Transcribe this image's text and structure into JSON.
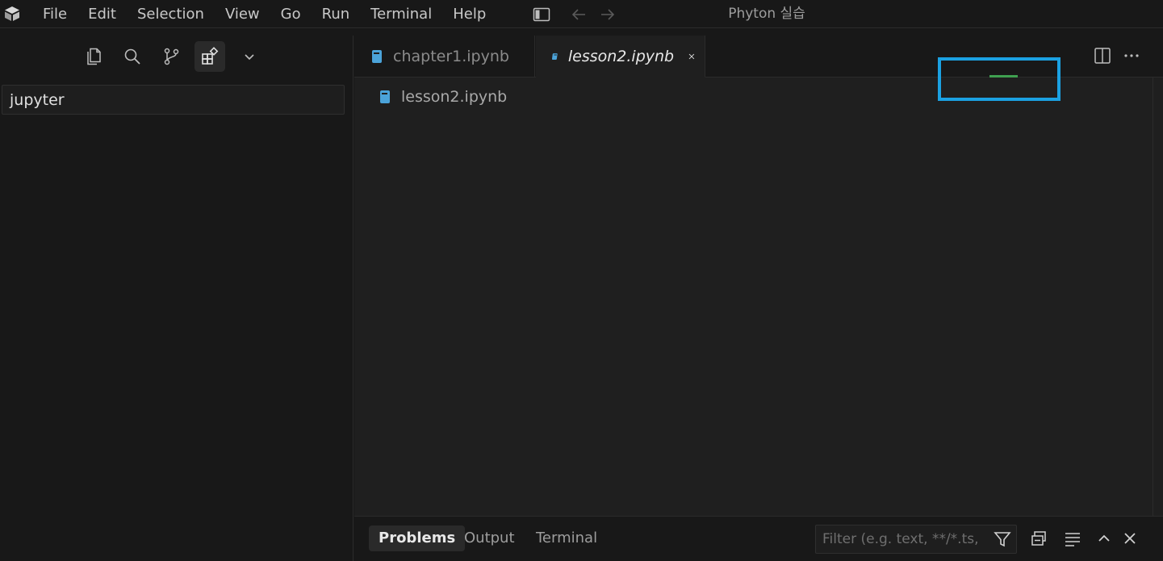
{
  "menu": {
    "items": [
      "File",
      "Edit",
      "Selection",
      "View",
      "Go",
      "Run",
      "Terminal",
      "Help"
    ]
  },
  "window": {
    "title": "Phyton 실습"
  },
  "sidebar": {
    "search_value": "jupyter"
  },
  "tabs": [
    {
      "label": "chapter1.ipynb",
      "active": false
    },
    {
      "label": "lesson2.ipynb",
      "active": true
    }
  ],
  "breadcrumb": {
    "file": "lesson2.ipynb"
  },
  "panel": {
    "tabs": [
      "Problems",
      "Output",
      "Terminal"
    ],
    "active_tab": "Problems",
    "filter_placeholder": "Filter (e.g. text, **/*.ts, !*..."
  },
  "icons": {
    "notebook": "notebook-icon",
    "close": "close-icon",
    "filter": "filter-icon"
  },
  "colors": {
    "accent_blue": "#1ba1e2",
    "notebook_icon": "#4ba3d9",
    "green_line": "#3fa050"
  }
}
